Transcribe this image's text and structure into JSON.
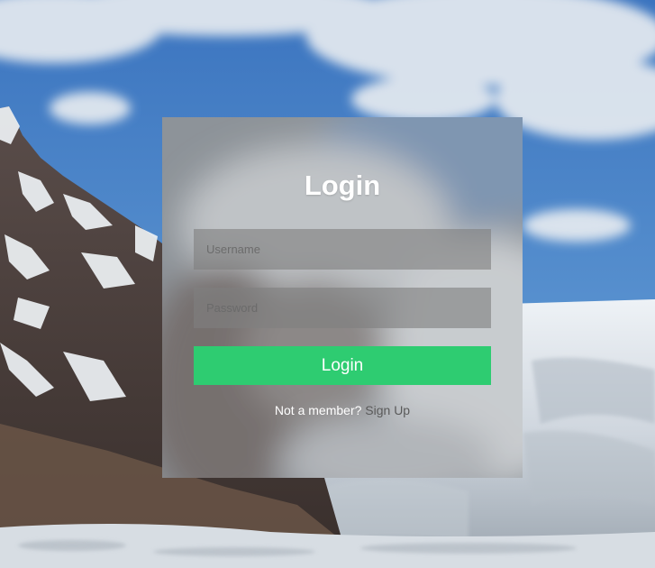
{
  "login": {
    "title": "Login",
    "username_placeholder": "Username",
    "password_placeholder": "Password",
    "button_label": "Login",
    "signup_prompt": "Not a member?",
    "signup_link": "Sign Up"
  },
  "colors": {
    "button": "#2ecc71",
    "sky": "#4a82c4",
    "card_overlay": "rgba(150,150,150,0.55)",
    "signup_link": "#5a5a5a"
  }
}
